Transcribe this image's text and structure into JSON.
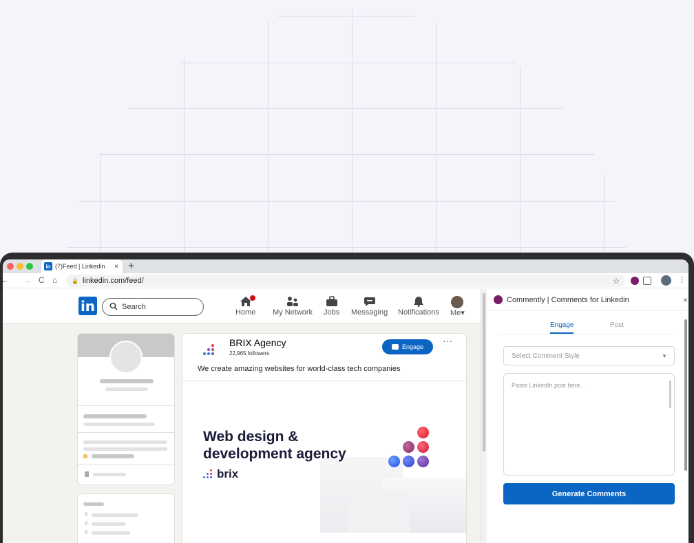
{
  "browser": {
    "tab_title": "(7)Feed | Linkedin",
    "tab_favicon": "in",
    "tab_close": "×",
    "new_tab": "+",
    "url": "linkedin.com/feed/",
    "nav_back": "←",
    "nav_forward": "→",
    "nav_reload": "C",
    "nav_home": "⌂",
    "lock": "🔒",
    "star": "☆",
    "menu": "⋮"
  },
  "linkedin": {
    "logo": "in",
    "search_placeholder": "Search",
    "nav": [
      {
        "label": "Home",
        "icon": "home-icon"
      },
      {
        "label": "My Network",
        "icon": "network-icon"
      },
      {
        "label": "Jobs",
        "icon": "briefcase-icon"
      },
      {
        "label": "Messaging",
        "icon": "message-icon"
      },
      {
        "label": "Notifications",
        "icon": "bell-icon"
      },
      {
        "label": "Me▾",
        "icon": "avatar"
      }
    ],
    "post": {
      "author": "BRIX Agency",
      "followers": "22,965 followers",
      "engage_label": "Engage",
      "more": "···",
      "text": "We create amazing websites for world-class tech companies",
      "image_headline": "Web design &\ndevelopment agency",
      "image_brand": "brix"
    }
  },
  "extension": {
    "title": "Commently | Comments for Linkedin",
    "close": "×",
    "tabs": [
      "Engage",
      "Post"
    ],
    "active_tab": "Engage",
    "select_placeholder": "Select Comment Style",
    "textarea_placeholder": "Paste LinkedIn post here...",
    "generate_label": "Generate Comments"
  },
  "colors": {
    "linkedin_blue": "#0a66c2",
    "extension_purple": "#7a1c6c",
    "notification_red": "#cc1016"
  }
}
